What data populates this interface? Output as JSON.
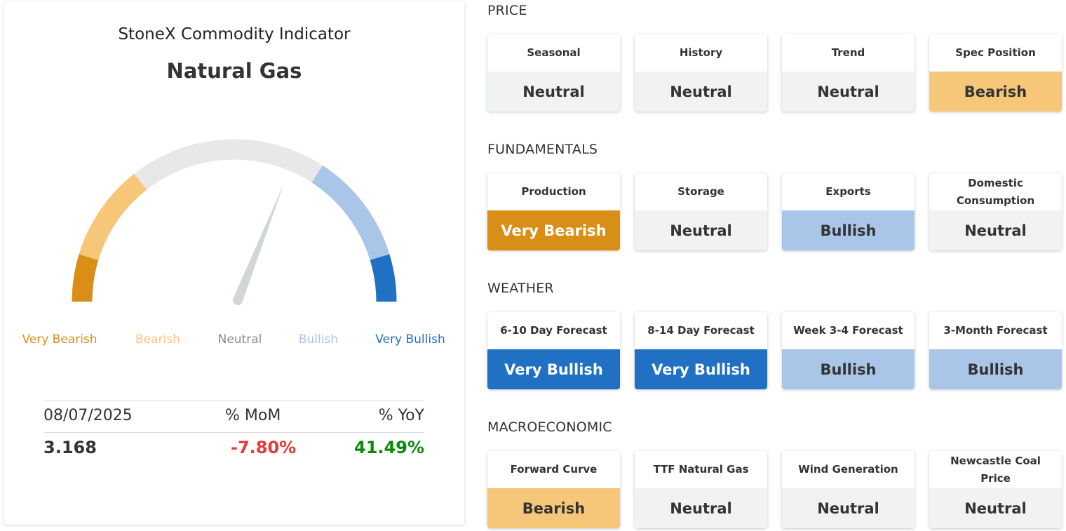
{
  "indicator": {
    "subtitle": "StoneX Commodity Indicator",
    "commodity": "Natural Gas",
    "gauge": {
      "needle_level": 0.62,
      "segments": [
        {
          "label": "Very Bearish",
          "color": "#d98e18"
        },
        {
          "label": "Bearish",
          "color": "#f6c679"
        },
        {
          "label": "Neutral",
          "color": "#e8e8e8"
        },
        {
          "label": "Bullish",
          "color": "#a9c6e8"
        },
        {
          "label": "Very Bullish",
          "color": "#2070c4"
        }
      ],
      "label_colors": [
        "#d98e18",
        "#f6c679",
        "#888888",
        "#a9c6e8",
        "#2070c4"
      ]
    },
    "stats": {
      "date": "08/07/2025",
      "mom_label": "% MoM",
      "yoy_label": "% YoY",
      "price": "3.168",
      "mom": "-7.80%",
      "yoy": "41.49%",
      "mom_color": "#e53935",
      "yoy_color": "#0a8a0a"
    }
  },
  "sections": [
    {
      "title": "PRICE",
      "tiles": [
        {
          "label": "Seasonal",
          "signal": "Neutral"
        },
        {
          "label": "History",
          "signal": "Neutral"
        },
        {
          "label": "Trend",
          "signal": "Neutral"
        },
        {
          "label": "Spec Position",
          "signal": "Bearish"
        }
      ]
    },
    {
      "title": "FUNDAMENTALS",
      "tiles": [
        {
          "label": "Production",
          "signal": "Very Bearish"
        },
        {
          "label": "Storage",
          "signal": "Neutral"
        },
        {
          "label": "Exports",
          "signal": "Bullish"
        },
        {
          "label": "Domestic Consumption",
          "signal": "Neutral"
        }
      ]
    },
    {
      "title": "WEATHER",
      "tiles": [
        {
          "label": "6-10 Day Forecast",
          "signal": "Very Bullish"
        },
        {
          "label": "8-14 Day Forecast",
          "signal": "Very Bullish"
        },
        {
          "label": "Week 3-4 Forecast",
          "signal": "Bullish"
        },
        {
          "label": "3-Month Forecast",
          "signal": "Bullish"
        }
      ]
    },
    {
      "title": "MACROECONOMIC",
      "tiles": [
        {
          "label": "Forward Curve",
          "signal": "Bearish"
        },
        {
          "label": "TTF Natural Gas",
          "signal": "Neutral"
        },
        {
          "label": "Wind Generation",
          "signal": "Neutral"
        },
        {
          "label": "Newcastle Coal Price",
          "signal": "Neutral"
        }
      ]
    }
  ]
}
